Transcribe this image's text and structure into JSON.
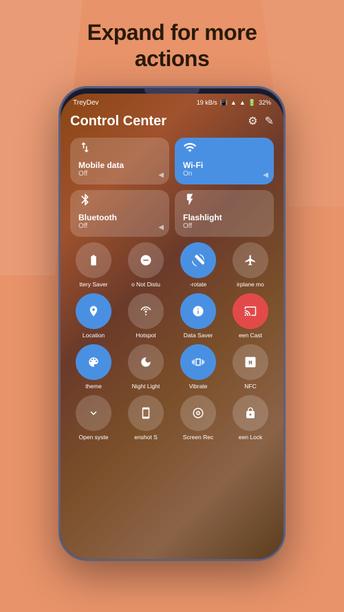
{
  "headline": {
    "line1": "Expand for more",
    "line2": "actions"
  },
  "status_bar": {
    "carrier": "TreyDev",
    "speed": "19 kB/s",
    "battery": "32%"
  },
  "control_center": {
    "title": "Control Center"
  },
  "large_tiles": [
    {
      "id": "mobile-data",
      "label": "Mobile data",
      "sublabel": "Off",
      "active": false,
      "icon": "↕"
    },
    {
      "id": "wifi",
      "label": "Wi-Fi",
      "sublabel": "On",
      "active": true,
      "icon": "wifi"
    },
    {
      "id": "bluetooth",
      "label": "Bluetooth",
      "sublabel": "Off",
      "active": false,
      "icon": "bt"
    },
    {
      "id": "flashlight",
      "label": "Flashlight",
      "sublabel": "Off",
      "active": false,
      "icon": "torch"
    }
  ],
  "small_tiles_row1": [
    {
      "id": "battery-saver",
      "label": "ttery Saver",
      "active": false,
      "icon": "battery",
      "color": "normal"
    },
    {
      "id": "dnd",
      "label": "o Not Distu",
      "active": false,
      "icon": "dnd",
      "color": "normal"
    },
    {
      "id": "rotate",
      "label": "-rotate",
      "active": true,
      "icon": "rotate",
      "color": "active"
    },
    {
      "id": "airplane",
      "label": "irplane mo",
      "active": false,
      "icon": "airplane",
      "color": "normal"
    }
  ],
  "small_tiles_row2": [
    {
      "id": "location",
      "label": "Location",
      "active": true,
      "icon": "location",
      "color": "active"
    },
    {
      "id": "hotspot",
      "label": "Hotspot",
      "active": false,
      "icon": "hotspot",
      "color": "normal"
    },
    {
      "id": "data-saver",
      "label": "Data Saver",
      "active": true,
      "icon": "datasaver",
      "color": "active"
    },
    {
      "id": "screen-cast",
      "label": "een Cast",
      "active": false,
      "icon": "cast",
      "color": "red"
    }
  ],
  "small_tiles_row3": [
    {
      "id": "theme",
      "label": "theme",
      "active": true,
      "icon": "theme",
      "color": "active"
    },
    {
      "id": "night-light",
      "label": "Night Light",
      "active": false,
      "icon": "moon",
      "color": "normal"
    },
    {
      "id": "vibrate",
      "label": "Vibrate",
      "active": true,
      "icon": "vibrate",
      "color": "active"
    },
    {
      "id": "nfc",
      "label": "NFC",
      "active": false,
      "icon": "nfc",
      "color": "normal"
    }
  ],
  "small_tiles_row4": [
    {
      "id": "open-syste",
      "label": "Open syste",
      "active": false,
      "icon": "chevron-down",
      "color": "normal"
    },
    {
      "id": "screenshot",
      "label": "enshot S",
      "active": false,
      "icon": "screenshot",
      "color": "normal"
    },
    {
      "id": "screen-rec",
      "label": "Screen Rec",
      "active": false,
      "icon": "screenrec",
      "color": "normal"
    },
    {
      "id": "screen-lock",
      "label": "een Lock",
      "active": false,
      "icon": "lock",
      "color": "normal"
    }
  ]
}
